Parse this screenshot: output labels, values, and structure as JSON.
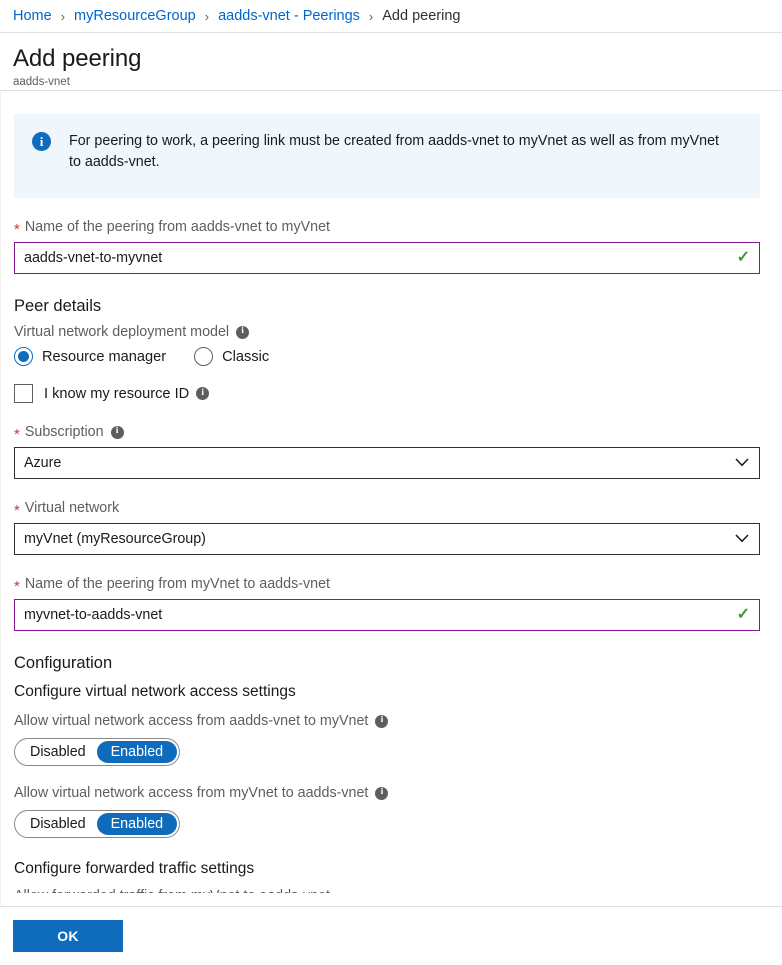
{
  "breadcrumb": {
    "separator": "›",
    "items": [
      {
        "label": "Home",
        "current": false
      },
      {
        "label": "myResourceGroup",
        "current": false
      },
      {
        "label": "aadds-vnet - Peerings",
        "current": false
      },
      {
        "label": "Add peering",
        "current": true
      }
    ]
  },
  "header": {
    "title": "Add peering",
    "subtitle": "aadds-vnet"
  },
  "banner": {
    "icon": "info-icon",
    "text": "For peering to work, a peering link must be created from aadds-vnet to myVnet as well as from myVnet to aadds-vnet.",
    "background": "#eff6fc",
    "icon_color": "#0f6cbd"
  },
  "fields": {
    "peering_name_1": {
      "label": "Name of the peering from aadds-vnet to myVnet",
      "required": true,
      "value": "aadds-vnet-to-myvnet",
      "placeholder": "",
      "valid": true,
      "valid_glyph": "✓",
      "border_color": "#881798",
      "check_color": "#3d9b35"
    },
    "peering_name_2": {
      "label": "Name of the peering from myVnet to aadds-vnet",
      "required": true,
      "value": "myvnet-to-aadds-vnet",
      "placeholder": "",
      "valid": true,
      "valid_glyph": "✓",
      "border_color": "#881798",
      "check_color": "#3d9b35"
    },
    "subscription": {
      "label": "Subscription",
      "required": true,
      "has_info": true,
      "value": "Azure"
    },
    "virtual_network": {
      "label": "Virtual network",
      "required": true,
      "has_info": false,
      "value": "myVnet (myResourceGroup)"
    }
  },
  "peer_details": {
    "heading": "Peer details",
    "deployment_model": {
      "label": "Virtual network deployment model",
      "has_info": true,
      "options": [
        {
          "label": "Resource manager",
          "checked": true
        },
        {
          "label": "Classic",
          "checked": false
        }
      ]
    },
    "resource_id_checkbox": {
      "label": "I know my resource ID",
      "checked": false,
      "has_info": true
    }
  },
  "configuration": {
    "heading": "Configuration",
    "access_settings_heading": "Configure virtual network access settings",
    "forwarded_traffic_heading": "Configure forwarded traffic settings",
    "clipped_text": "Allow forwarded traffic from myVnet to aadds-vnet",
    "toggles": [
      {
        "label": "Allow virtual network access from aadds-vnet to myVnet",
        "has_info": true,
        "off_label": "Disabled",
        "on_label": "Enabled",
        "value": "Enabled"
      },
      {
        "label": "Allow virtual network access from myVnet to aadds-vnet",
        "has_info": true,
        "off_label": "Disabled",
        "on_label": "Enabled",
        "value": "Enabled"
      }
    ]
  },
  "footer": {
    "ok_label": "OK",
    "accent_color": "#0f6cbd"
  },
  "icons": {
    "info_glyph": "i",
    "chevron_down": "chevron-down-icon"
  }
}
